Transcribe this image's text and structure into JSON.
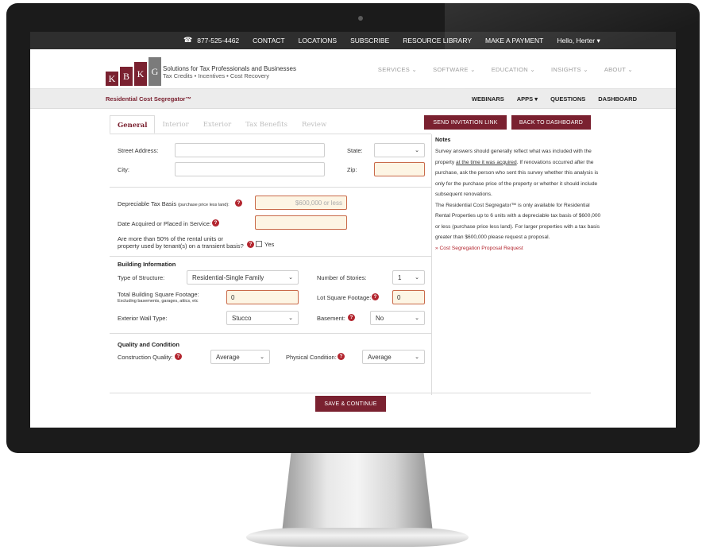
{
  "topbar": {
    "phone": "877-525-4462",
    "links": [
      "CONTACT",
      "LOCATIONS",
      "SUBSCRIBE",
      "RESOURCE LIBRARY",
      "MAKE A PAYMENT"
    ],
    "user": "Hello, Herter"
  },
  "header": {
    "logo_letters": [
      "K",
      "B",
      "K",
      "G"
    ],
    "tagline_1": "Solutions for Tax Professionals and Businesses",
    "tagline_2": "Tax Credits • Incentives • Cost Recovery",
    "nav": [
      "SERVICES",
      "SOFTWARE",
      "EDUCATION",
      "INSIGHTS",
      "ABOUT"
    ]
  },
  "subbar": {
    "product": "Residential Cost Segregator™",
    "nav": [
      "WEBINARS",
      "APPS",
      "QUESTIONS",
      "DASHBOARD"
    ]
  },
  "tabs": [
    "General",
    "Interior",
    "Exterior",
    "Tax Benefits",
    "Review"
  ],
  "buttons": {
    "send_invitation": "SEND INVITATION LINK",
    "back_dashboard": "BACK TO DASHBOARD",
    "save_continue": "SAVE & CONTINUE"
  },
  "form": {
    "street_label": "Street Address:",
    "state_label": "State:",
    "city_label": "City:",
    "zip_label": "Zip:",
    "basis_label": "Depreciable Tax Basis",
    "basis_note": "(purchase price less land):",
    "basis_placeholder": "$600,000 or less",
    "date_label": "Date Acquired or Placed in Service:",
    "transient_label_1": "Are more than 50% of the rental units or",
    "transient_label_2": "property used by tenant(s) on a transient basis?",
    "yes_label": "Yes",
    "building_title": "Building Information",
    "structure_label": "Type of Structure:",
    "structure_value": "Residential-Single Family",
    "stories_label": "Number of Stories:",
    "stories_value": "1",
    "sqft_label": "Total Building Square Footage:",
    "sqft_note": "Excluding basements, garages, attics, etc",
    "sqft_value": "0",
    "lot_label": "Lot Square Footage:",
    "lot_value": "0",
    "wall_label": "Exterior Wall Type:",
    "wall_value": "Stucco",
    "basement_label": "Basement:",
    "basement_value": "No",
    "quality_title": "Quality and Condition",
    "construction_label": "Construction Quality:",
    "construction_value": "Average",
    "physical_label": "Physical Condition:",
    "physical_value": "Average"
  },
  "notes": {
    "title": "Notes",
    "p1_a": "Survey answers should generally reflect what was included with the property",
    "p1_u": "at the time it was acquired",
    "p1_b": ". If renovations occurred after the purchase, ask the person who sent this survey whether this analysis is only for the purchase price of the property or whether it should include subsequent renovations.",
    "p2": "The Residential Cost Segregator™ is only available for Residential Rental Properties up to 6 units with a depreciable tax basis of $600,000 or less (purchase price less land). For larger properties with a tax basis greater than $600,000 please request a proposal.",
    "link": "» Cost Segregation Proposal Request"
  }
}
